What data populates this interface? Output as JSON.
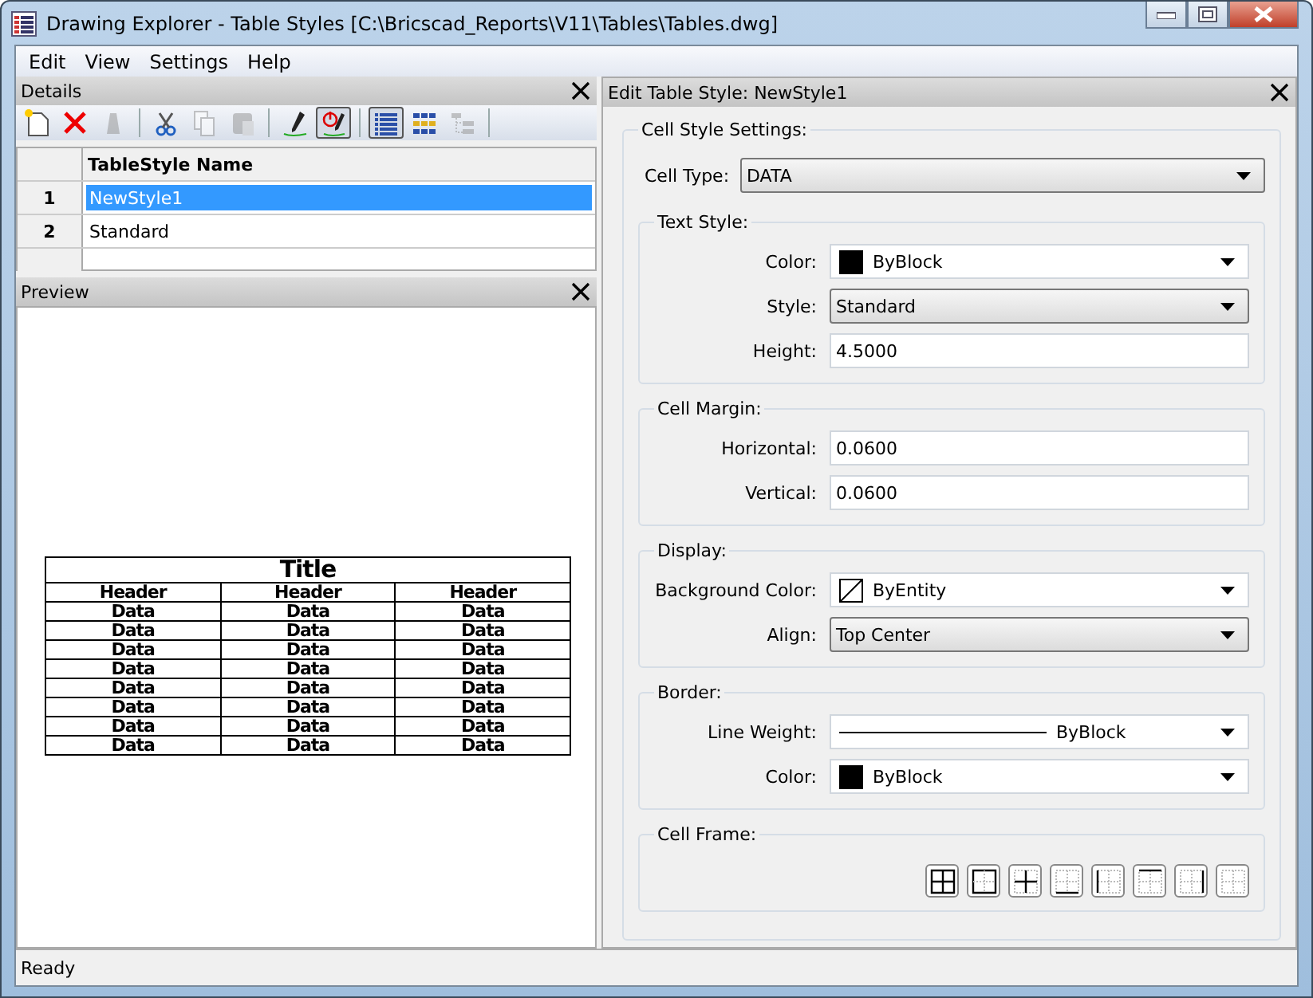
{
  "window": {
    "title": "Drawing Explorer - Table Styles [C:\\Bricscad_Reports\\V11\\Tables\\Tables.dwg]"
  },
  "menu": [
    "Edit",
    "View",
    "Settings",
    "Help"
  ],
  "details": {
    "title": "Details",
    "toolbar": [
      {
        "disabled": false,
        "pressed": false
      },
      {
        "disabled": false,
        "pressed": false
      },
      {
        "disabled": true,
        "pressed": false
      },
      {
        "disabled": false,
        "pressed": false
      },
      {
        "disabled": true,
        "pressed": false
      },
      {
        "disabled": true,
        "pressed": false
      },
      {
        "disabled": false,
        "pressed": false
      },
      {
        "disabled": false,
        "pressed": true
      },
      {
        "disabled": false,
        "pressed": true
      },
      {
        "disabled": false,
        "pressed": false
      },
      {
        "disabled": true,
        "pressed": false
      }
    ],
    "column": "TableStyle Name",
    "rows": [
      {
        "number": "1",
        "name": "NewStyle1",
        "selected": true
      },
      {
        "number": "2",
        "name": "Standard",
        "selected": false
      }
    ]
  },
  "preview": {
    "title": "Preview",
    "table_title": "Title",
    "headers": [
      "Header",
      "Header",
      "Header"
    ],
    "rows": [
      [
        "Data",
        "Data",
        "Data"
      ],
      [
        "Data",
        "Data",
        "Data"
      ],
      [
        "Data",
        "Data",
        "Data"
      ],
      [
        "Data",
        "Data",
        "Data"
      ],
      [
        "Data",
        "Data",
        "Data"
      ],
      [
        "Data",
        "Data",
        "Data"
      ],
      [
        "Data",
        "Data",
        "Data"
      ],
      [
        "Data",
        "Data",
        "Data"
      ]
    ]
  },
  "editor": {
    "title": "Edit Table Style: NewStyle1",
    "group": "Cell Style Settings:",
    "cell_type": {
      "label": "Cell Type:",
      "value": "DATA",
      "kind": "combo"
    },
    "sections": [
      {
        "title": "Text Style:",
        "fields": [
          {
            "label": "Color:",
            "value": "ByBlock",
            "kind": "color"
          },
          {
            "label": "Style:",
            "value": "Standard",
            "kind": "combo"
          },
          {
            "label": "Height:",
            "value": "4.5000",
            "kind": "input"
          }
        ]
      },
      {
        "title": "Cell Margin:",
        "fields": [
          {
            "label": "Horizontal:",
            "value": "0.0600",
            "kind": "input"
          },
          {
            "label": "Vertical:",
            "value": "0.0600",
            "kind": "input"
          }
        ]
      },
      {
        "title": "Display:",
        "fields": [
          {
            "label": "Background Color:",
            "value": "ByEntity",
            "kind": "nocolor"
          },
          {
            "label": "Align:",
            "value": "Top Center",
            "kind": "combo"
          }
        ]
      },
      {
        "title": "Border:",
        "fields": [
          {
            "label": "Line Weight:",
            "value": "ByBlock",
            "kind": "lineweight"
          },
          {
            "label": "Color:",
            "value": "ByBlock",
            "kind": "color"
          }
        ]
      },
      {
        "title": "Cell Frame:"
      }
    ]
  },
  "status_bar": "Ready"
}
